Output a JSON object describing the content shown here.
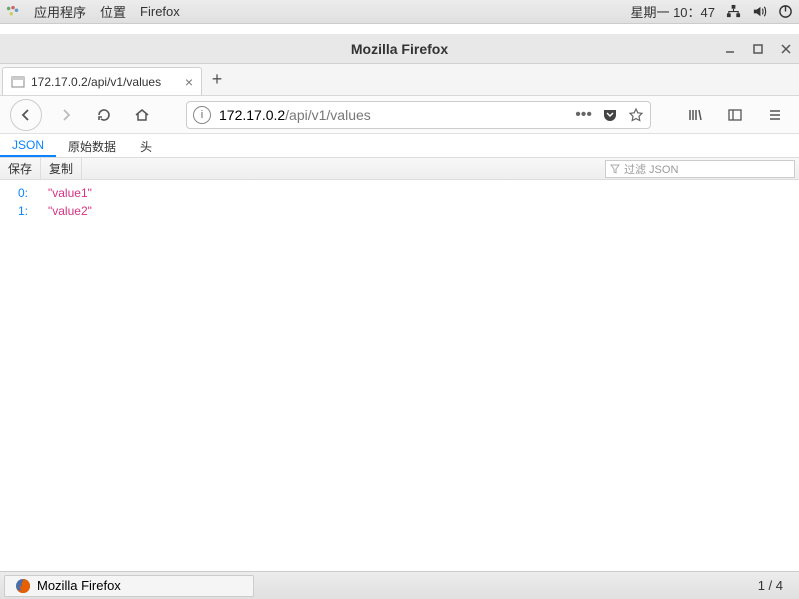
{
  "gnome": {
    "applications": "应用程序",
    "places": "位置",
    "firefox": "Firefox",
    "datetime": "星期一 10：47"
  },
  "window": {
    "title": "Mozilla Firefox"
  },
  "tab": {
    "title": "172.17.0.2/api/v1/values"
  },
  "url": {
    "host": "172.17.0.2",
    "path": "/api/v1/values"
  },
  "jsonViewer": {
    "tabs": {
      "json": "JSON",
      "raw": "原始数据",
      "head": "头"
    },
    "toolbar": {
      "save": "保存",
      "copy": "复制",
      "filterPlaceholder": "过滤 JSON"
    },
    "data": [
      {
        "k": "0:",
        "v": "\"value1\""
      },
      {
        "k": "1:",
        "v": "\"value2\""
      }
    ]
  },
  "taskbar": {
    "app": "Mozilla Firefox",
    "workspace": "1 / 4"
  }
}
